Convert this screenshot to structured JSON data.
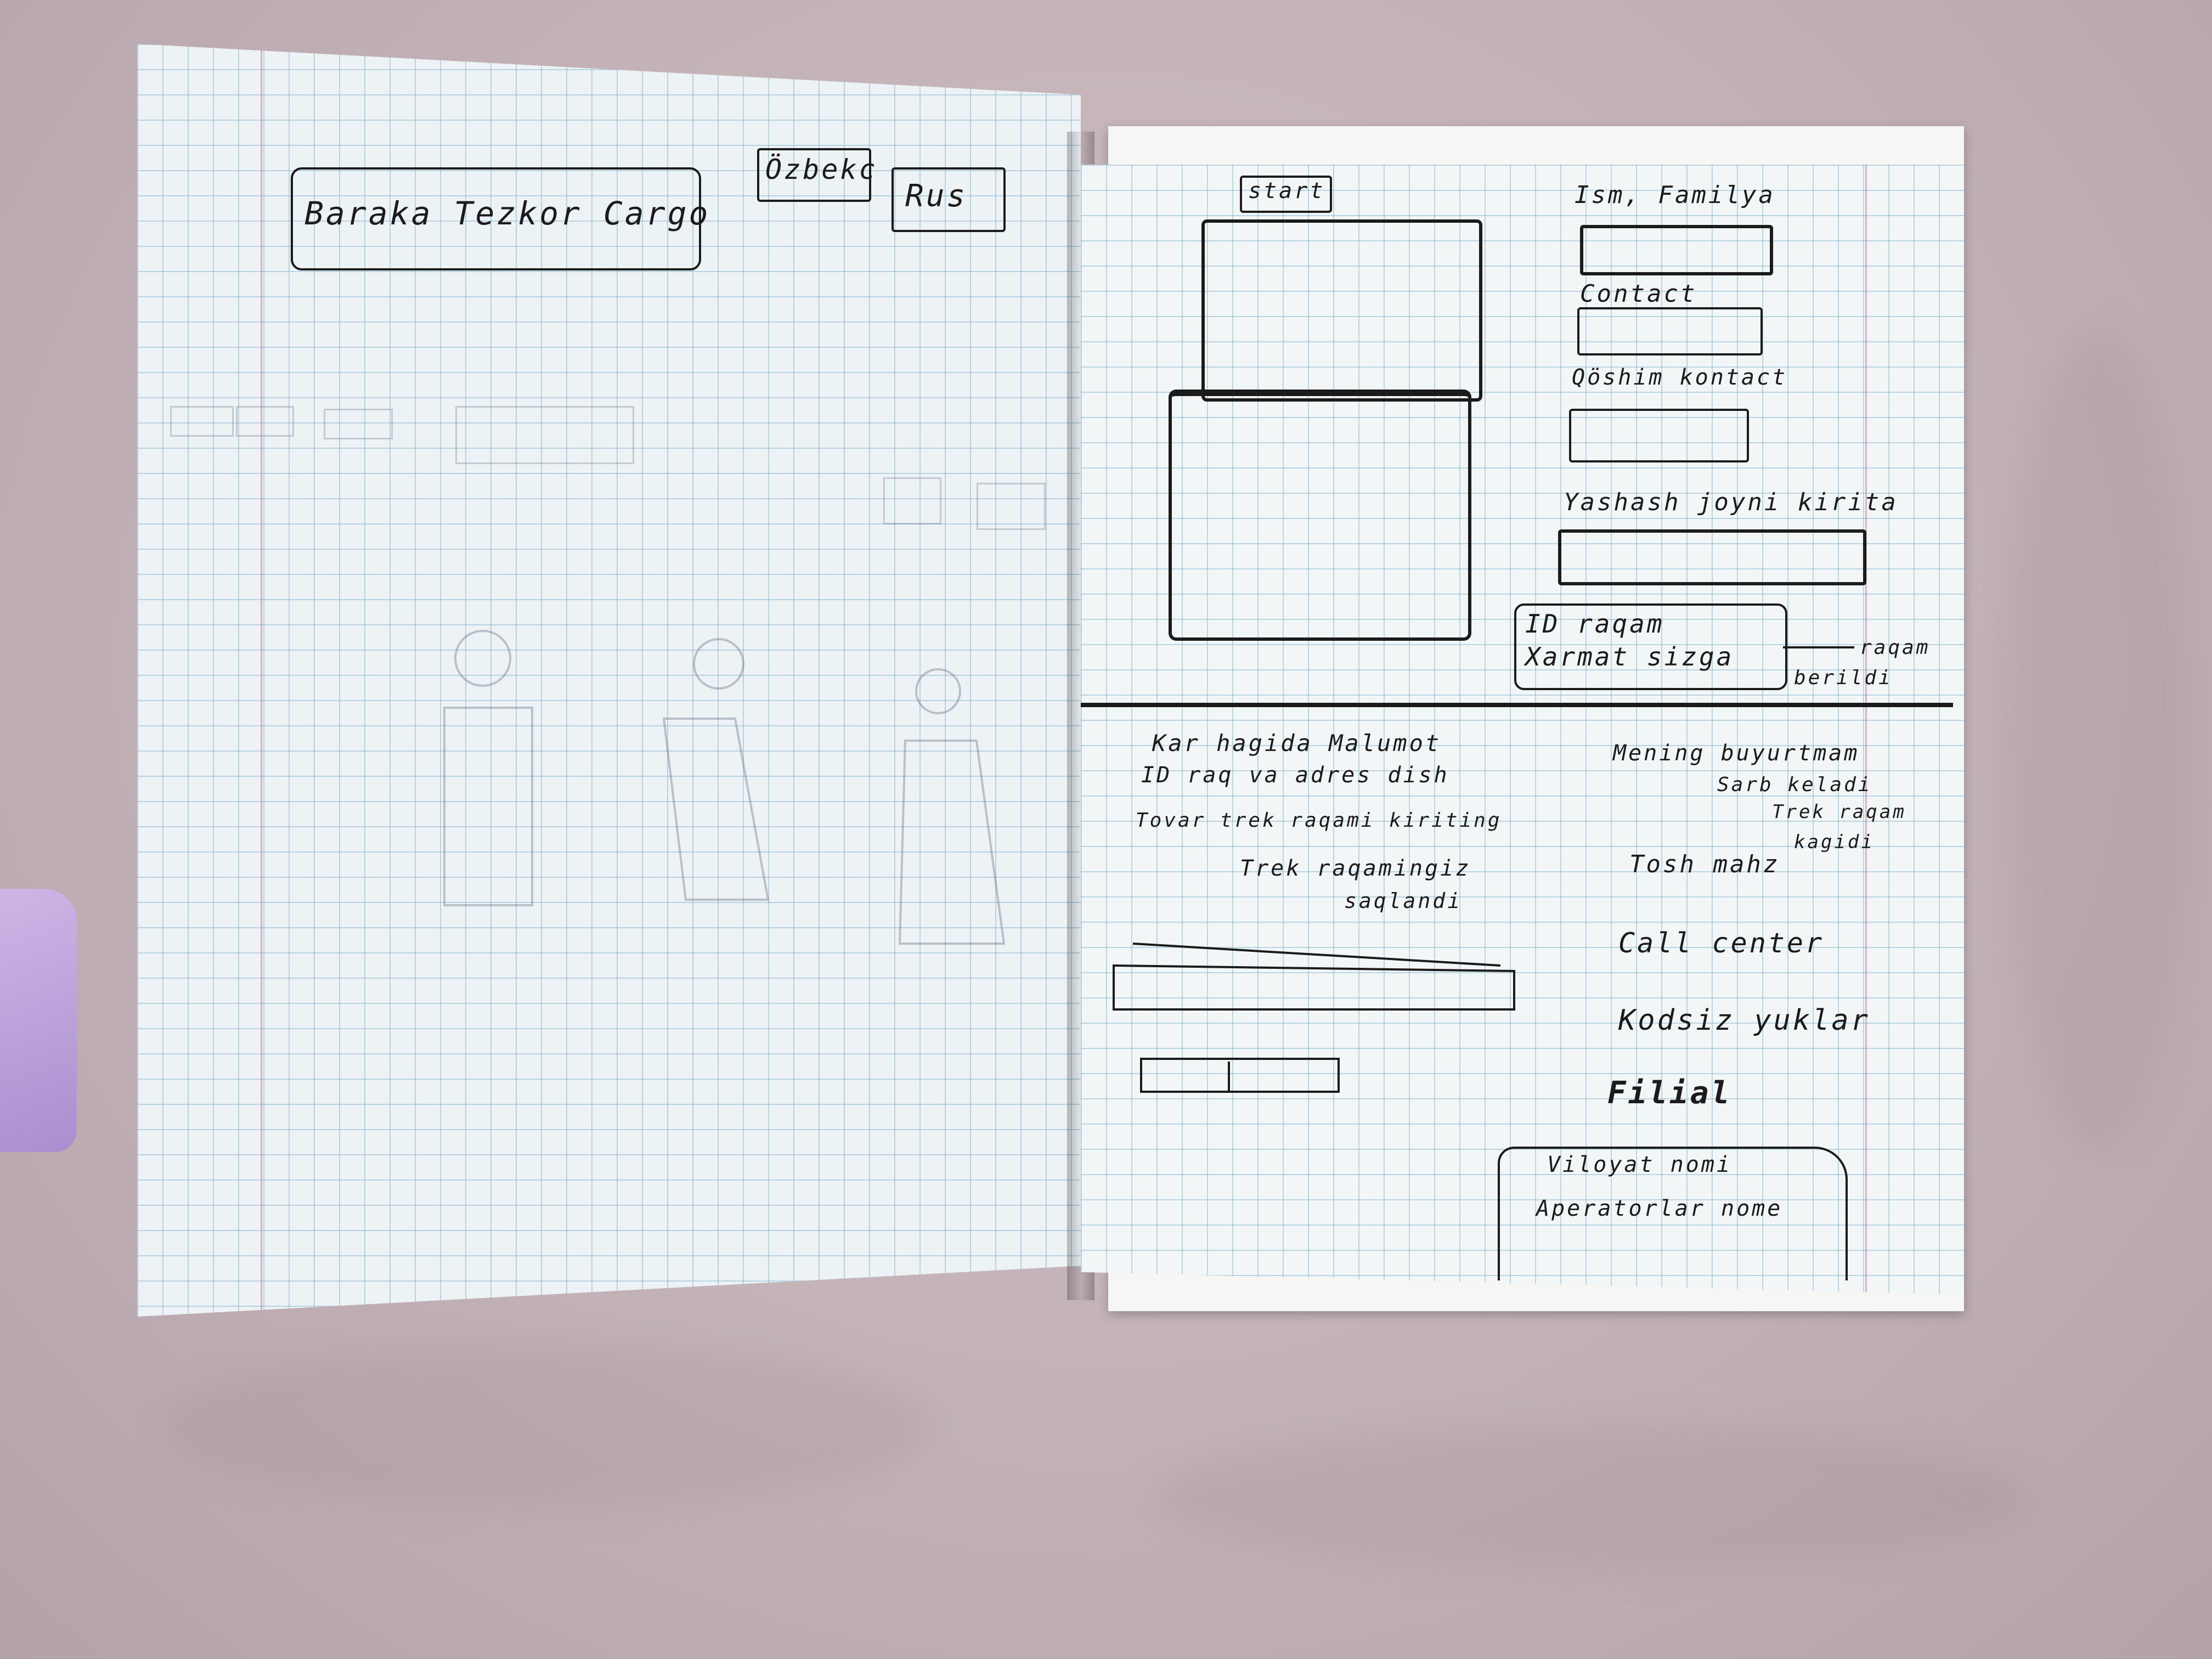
{
  "left_page": {
    "lang_uzbek": "Özbekc",
    "lang_russian": "Rus",
    "title": "Baraka Tezkor Cargo"
  },
  "right_page": {
    "start_label": "start",
    "form": {
      "name_label": "Ism, Familya",
      "contact_label": "Contact",
      "address_label": "Qöshim kontaсt",
      "location_label": "Yashash joyni kiritа",
      "id_box_line1": "ID raqam",
      "id_box_line2": "Xarmat sizga",
      "id_side_note_1": "raqam",
      "id_side_note_2": "berildi"
    },
    "info": {
      "line1": "Kar hagida Malumot",
      "line2": "ID raq va adres dish",
      "line3": "Tovar trek raqami kiriting",
      "line4": "Trek raqamingiz",
      "line5": "saqlandi"
    },
    "menu": {
      "item1_a": "Mening buyurtmam",
      "item1_b": "Sarb keladi",
      "item1_c": "Trek raqam",
      "item1_d": "kagidi",
      "item2": "Tosh mahz",
      "item3": "Call center",
      "item4": "Kodsiz yuklar",
      "item5": "Filial"
    },
    "filial_box": {
      "line1": "Viloyat nomi",
      "line2": "Aperatorlar nome"
    }
  }
}
